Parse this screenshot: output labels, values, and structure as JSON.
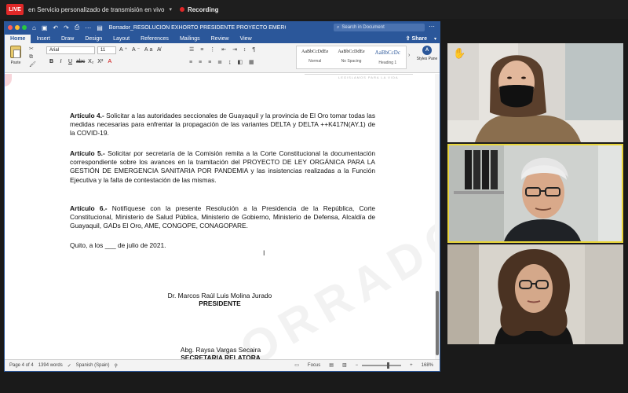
{
  "zoom_bar": {
    "live_badge": "LIVE",
    "stream_label": "en Servicio personalizado de transmisión en vivo",
    "stream_caret": "▾",
    "recording_label": "Recording"
  },
  "word": {
    "title": "Borrador_RESOLUCIÓN EXHORTO PRESIDENTE PROYECTO EMERGENCIA...",
    "search_placeholder": "Search in Document",
    "tabs": [
      "Home",
      "Insert",
      "Draw",
      "Design",
      "Layout",
      "References",
      "Mailings",
      "Review",
      "View"
    ],
    "active_tab": "Home",
    "share_label": "Share",
    "ribbon": {
      "paste_label": "Paste",
      "font_name": "Arial",
      "font_size": "11",
      "bold": "B",
      "italic": "I",
      "underline": "U",
      "strikethrough": "abc",
      "subscript": "X₂",
      "superscript": "X²",
      "font_color": "A",
      "styles": [
        {
          "sample": "AaBbCcDdEe",
          "name": "Normal"
        },
        {
          "sample": "AaBbCcDdEe",
          "name": "No Spacing"
        },
        {
          "sample": "AaBbCcDc",
          "name": "Heading 1"
        }
      ],
      "styles_pane_label": "Styles Pane"
    },
    "document": {
      "header_motto": "LEGISLAMOS PARA LA VIDA",
      "watermark": "BORRADOR",
      "articles": [
        {
          "label": "Artículo 4.-",
          "text": " Solicitar a las autoridades seccionales de Guayaquil y la provincia de El Oro tomar todas las medidas necesarias para enfrentar la propagación de las variantes DELTA y DELTA ++K417N(AY.1) de la COVID-19."
        },
        {
          "label": "Artículo 5.-",
          "text": " Solicitar por secretaría de la Comisión remita a la Corte Constitucional la documentación correspondiente sobre los avances en la tramitación del PROYECTO DE LEY ORGÁNICA PARA LA GESTIÓN DE EMERGENCIA SANITARIA POR PANDEMIA y las insistencias realizadas a la Función Ejecutiva y la falta de contestación de las mismas."
        },
        {
          "label": "Artículo 6.-",
          "text": " Notifíquese con la presente Resolución a la Presidencia de la República, Corte Constitucional, Ministerio de Salud Pública, Ministerio de Gobierno, Ministerio de Defensa, Alcaldía de Guayaquil, GADs El Oro, AME, CONGOPE, CONAGOPARE."
        }
      ],
      "date_line": "Quito,  a los ___ de julio de 2021.",
      "signatures": [
        {
          "name": "Dr. Marcos Raúl Luis Molina Jurado",
          "role": "PRESIDENTE"
        },
        {
          "name": "Abg. Raysa Vargas Secaira",
          "role": "SECRETARIA RELATORA"
        }
      ]
    },
    "status": {
      "page": "Page 4 of 4",
      "words": "1394 words",
      "language": "Spanish (Spain)",
      "focus": "Focus",
      "zoom": "168%"
    }
  },
  "participants": [
    {
      "name": "participant-woman-mask",
      "hand_raised": true
    },
    {
      "name": "participant-man-glasses",
      "active_speaker": true
    },
    {
      "name": "participant-woman-curly"
    }
  ],
  "colors": {
    "word_blue": "#2b579a",
    "live_red": "#e02828",
    "active_speaker_border": "#e8d53a"
  }
}
